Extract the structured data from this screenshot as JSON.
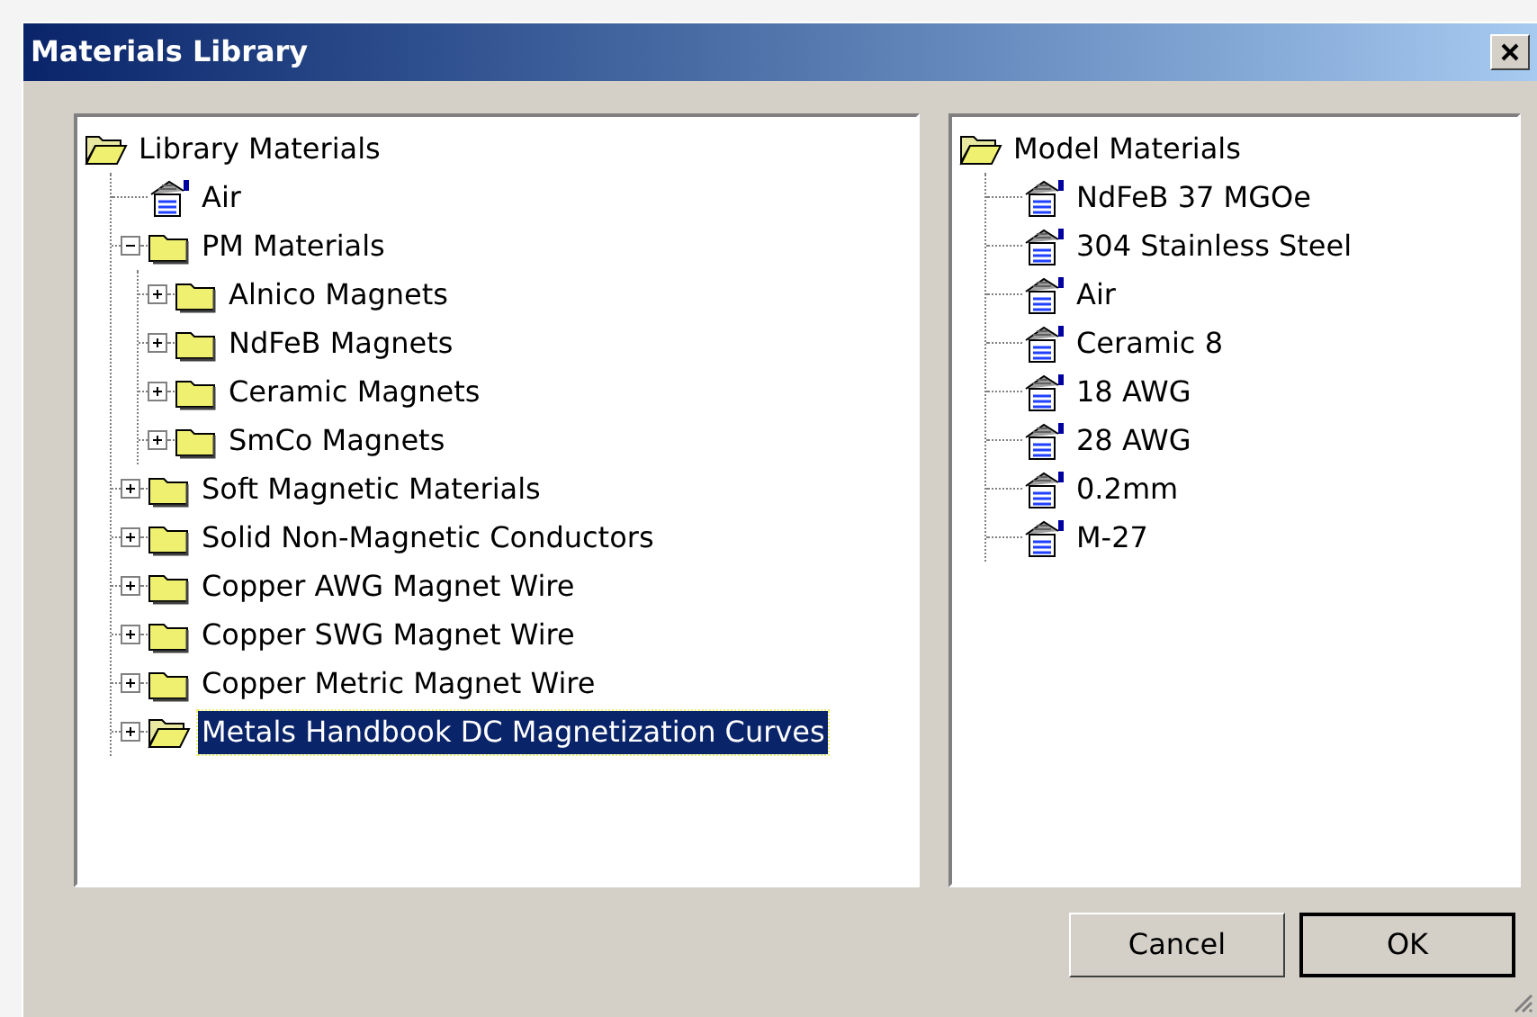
{
  "window": {
    "title": "Materials Library"
  },
  "library_tree": [
    {
      "label": "Library Materials",
      "kind": "folder",
      "open": true,
      "selected": false,
      "children": [
        {
          "label": "Air",
          "kind": "material",
          "selected": false
        },
        {
          "label": "PM Materials",
          "kind": "folder",
          "open": false,
          "expanded": true,
          "selected": false,
          "children": [
            {
              "label": "Alnico Magnets",
              "kind": "folder",
              "open": false,
              "expanded": false,
              "selected": false
            },
            {
              "label": "NdFeB Magnets",
              "kind": "folder",
              "open": false,
              "expanded": false,
              "selected": false
            },
            {
              "label": "Ceramic Magnets",
              "kind": "folder",
              "open": false,
              "expanded": false,
              "selected": false
            },
            {
              "label": "SmCo Magnets",
              "kind": "folder",
              "open": false,
              "expanded": false,
              "selected": false
            }
          ]
        },
        {
          "label": "Soft Magnetic Materials",
          "kind": "folder",
          "open": false,
          "expanded": false,
          "selected": false
        },
        {
          "label": "Solid Non-Magnetic Conductors",
          "kind": "folder",
          "open": false,
          "expanded": false,
          "selected": false
        },
        {
          "label": "Copper AWG Magnet Wire",
          "kind": "folder",
          "open": false,
          "expanded": false,
          "selected": false
        },
        {
          "label": "Copper SWG Magnet Wire",
          "kind": "folder",
          "open": false,
          "expanded": false,
          "selected": false
        },
        {
          "label": "Copper Metric Magnet Wire",
          "kind": "folder",
          "open": false,
          "expanded": false,
          "selected": false
        },
        {
          "label": "Metals Handbook DC Magnetization Curves",
          "kind": "folder",
          "open": true,
          "expanded": false,
          "selected": true
        }
      ]
    }
  ],
  "model_tree": [
    {
      "label": "Model Materials",
      "kind": "folder",
      "open": true,
      "selected": false,
      "children": [
        {
          "label": "NdFeB 37 MGOe",
          "kind": "material",
          "selected": false
        },
        {
          "label": "304 Stainless Steel",
          "kind": "material",
          "selected": false
        },
        {
          "label": "Air",
          "kind": "material",
          "selected": false
        },
        {
          "label": "Ceramic 8",
          "kind": "material",
          "selected": false
        },
        {
          "label": "18 AWG",
          "kind": "material",
          "selected": false
        },
        {
          "label": "28 AWG",
          "kind": "material",
          "selected": false
        },
        {
          "label": "0.2mm",
          "kind": "material",
          "selected": false
        },
        {
          "label": "M-27",
          "kind": "material",
          "selected": false
        }
      ]
    }
  ],
  "buttons": [
    {
      "label": "Cancel",
      "default": false
    },
    {
      "label": "OK",
      "default": true
    }
  ]
}
